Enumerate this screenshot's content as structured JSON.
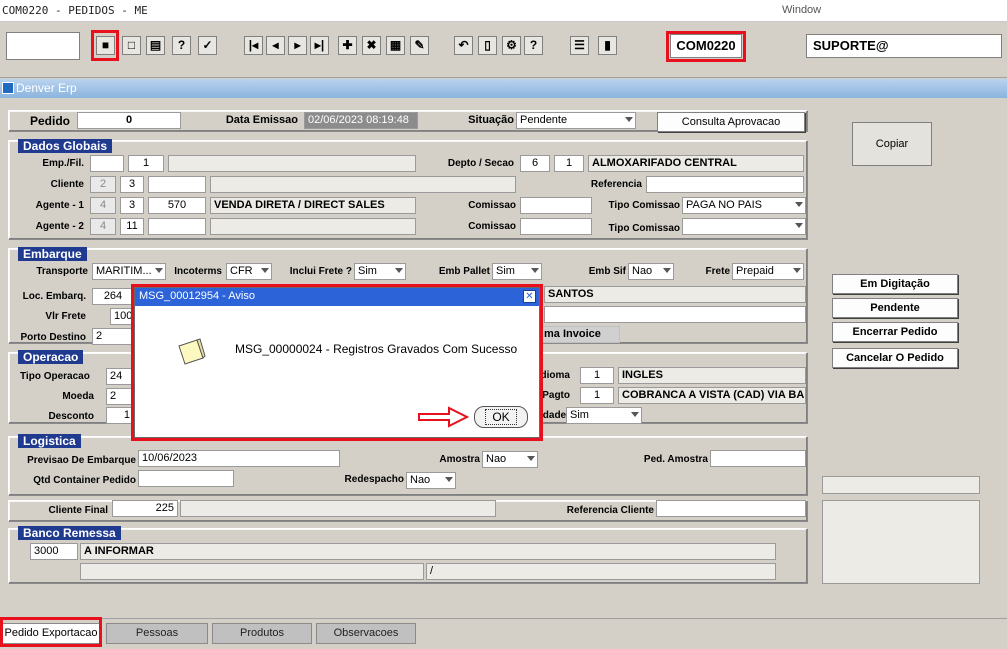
{
  "window": {
    "title": "COM0220 - PEDIDOS - ME",
    "menu": "Window"
  },
  "toolbar": {
    "form_code": "COM0220",
    "user": "SUPORTE@",
    "icons": [
      "save-icon",
      "window-icon",
      "print-icon",
      "help-query-icon",
      "execute-icon",
      "first-record-icon",
      "prev-record-icon",
      "next-record-icon",
      "last-record-icon",
      "insert-record-icon",
      "delete-record-icon",
      "commit-icon",
      "clear-icon",
      "undo-icon",
      "copy-icon",
      "settings-icon",
      "help-icon",
      "menu-icon",
      "exit-icon"
    ],
    "glyphs": [
      "■",
      "□",
      "▤",
      "?",
      "✓",
      "|◂",
      "◂",
      "▸",
      "▸|",
      "✚",
      "✖",
      "▦",
      "✎",
      "↶",
      "▯",
      "⚙",
      "?",
      "☰",
      "▮"
    ]
  },
  "app": {
    "name": "Denver Erp"
  },
  "pedido": {
    "label": "Pedido",
    "value": "0",
    "data_emissao_label": "Data Emissao",
    "data_emissao": "02/06/2023 08:19:48",
    "situacao_label": "Situação",
    "situacao": "Pendente",
    "consulta_button": "Consulta Aprovacao",
    "copiar_button": "Copiar"
  },
  "dados_globais": {
    "title": "Dados Globais",
    "emp_label": "Emp./Fil.",
    "emp_value": "1",
    "depto_label": "Depto / Secao",
    "depto_1": "6",
    "depto_2": "1",
    "depto_name": "ALMOXARIFADO CENTRAL",
    "cliente_label": "Cliente",
    "cliente_1": "2",
    "cliente_2": "3",
    "referencia_label": "Referencia",
    "agente1_label": "Agente - 1",
    "agente1_a": "4",
    "agente1_b": "3",
    "agente1_code": "570",
    "agente1_name": "VENDA DIRETA / DIRECT SALES",
    "comissao_label": "Comissao",
    "tipo_comissao_label": "Tipo Comissao",
    "tipo_comissao": "PAGA NO PAIS",
    "agente2_label": "Agente - 2",
    "agente2_a": "4",
    "agente2_b": "11",
    "comissao2_label": "Comissao",
    "tipo_comissao2_label": "Tipo Comissao",
    "tipo_comissao2": ""
  },
  "embarque": {
    "title": "Embarque",
    "transporte_label": "Transporte",
    "transporte": "MARITIM...",
    "incoterms_label": "Incoterms",
    "incoterms": "CFR",
    "inclui_frete_label": "Inclui Frete ?",
    "inclui_frete": "Sim",
    "emb_pallet_label": "Emb Pallet",
    "emb_pallet": "Sim",
    "emb_sif_label": "Emb Sif",
    "emb_sif": "Nao",
    "frete_label": "Frete",
    "frete": "Prepaid",
    "loc_embarq_label": "Loc. Embarq.",
    "loc_embarq": "264",
    "loc_embarq_name": "SANTOS",
    "vlr_frete_label": "Vlr Frete",
    "vlr_frete": "100",
    "porto_destino_label": "Porto Destino",
    "porto_destino": "2",
    "proforma_label": "ma Invoice"
  },
  "operacao": {
    "title": "Operacao",
    "tipo_label": "Tipo Operacao",
    "tipo": "24",
    "moeda_label": "Moeda",
    "moeda": "2",
    "desconto_label": "Desconto",
    "desconto": "1",
    "idioma_label": "dioma",
    "idioma_code": "1",
    "idioma": "INGLES",
    "pagto_label": "Pagto",
    "pagto_code": "1",
    "pagto": "COBRANCA A VISTA (CAD) VIA BA",
    "idade_label": "idade",
    "idade": "Sim"
  },
  "logistica": {
    "title": "Logistica",
    "previsao_label": "Previsao De Embarque",
    "previsao": "10/06/2023",
    "amostra_label": "Amostra",
    "amostra": "Nao",
    "ped_amostra_label": "Ped. Amostra",
    "qtd_container_label": "Qtd Container Pedido",
    "redespacho_label": "Redespacho",
    "redespacho": "Nao"
  },
  "cliente_final": {
    "label": "Cliente Final",
    "value": "225",
    "referencia_label": "Referencia Cliente"
  },
  "banco_remessa": {
    "title": "Banco Remessa",
    "code": "3000",
    "name": "A INFORMAR",
    "sep": "/"
  },
  "actions": {
    "em_digitacao": "Em Digitação",
    "pendente": "Pendente",
    "encerrar": "Encerrar Pedido",
    "cancelar": "Cancelar O Pedido"
  },
  "tabs": [
    "Pedido Exportacao",
    "Pessoas",
    "Produtos",
    "Observacoes"
  ],
  "dialog": {
    "title": "MSG_00012954 - Aviso",
    "message": "MSG_00000024 - Registros Gravados Com Sucesso",
    "ok": "OK",
    "close": "✕"
  },
  "colors": {
    "highlight": "#e8101c",
    "section": "#1f3a8f",
    "dialog_title": "#2c63d9"
  }
}
